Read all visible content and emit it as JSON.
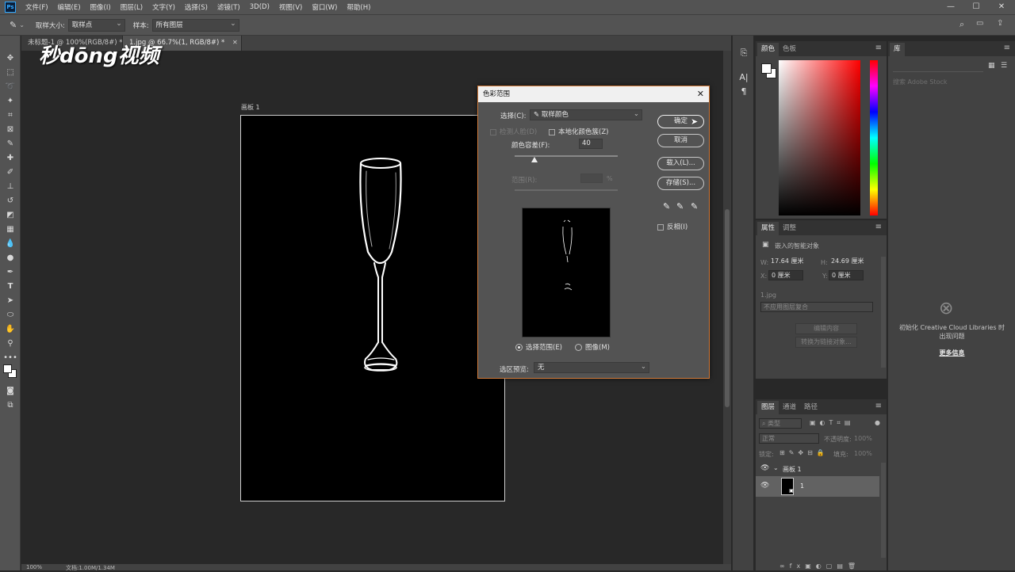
{
  "app": {
    "logo": "Ps"
  },
  "menubar": {
    "items": [
      "文件(F)",
      "编辑(E)",
      "图像(I)",
      "图层(L)",
      "文字(Y)",
      "选择(S)",
      "滤镜(T)",
      "3D(D)",
      "视图(V)",
      "窗口(W)",
      "帮助(H)"
    ],
    "minimize": "—",
    "maximize": "☐",
    "close": "✕"
  },
  "options": {
    "sample_size_label": "取样大小:",
    "sample_size_value": "取样点",
    "sample_label": "样本:",
    "sample_value": "所有图层"
  },
  "watermark": "秒dōng视频",
  "doc_tabs": [
    {
      "label": "未标题-1 @ 100%(RGB/8#) *"
    },
    {
      "label": "1.jpg @ 66.7%(1, RGB/8#) *"
    }
  ],
  "canvas": {
    "artboard_label": "画板 1"
  },
  "status": {
    "zoom": "100%",
    "doc": "文档:1.00M/1.34M"
  },
  "dialog": {
    "title": "色彩范围",
    "close": "✕",
    "select_label": "选择(C):",
    "select_value": "取样颜色",
    "detect_faces": "检测人脸(D)",
    "localized": "本地化颜色簇(Z)",
    "fuzziness_label": "颜色容差(F):",
    "fuzziness_value": "40",
    "range_label": "范围(R):",
    "range_unit": "%",
    "radio_selection": "选择范围(E)",
    "radio_image": "图像(M)",
    "preview_label": "选区预览:",
    "preview_value": "无",
    "btn_ok": "确定",
    "btn_cancel": "取消",
    "btn_load": "载入(L)...",
    "btn_save": "存储(S)...",
    "invert": "反相(I)"
  },
  "color_panel": {
    "tabs": [
      "颜色",
      "色板"
    ],
    "accent": "#ff0000"
  },
  "properties_panel": {
    "tabs": [
      "属性",
      "调整"
    ],
    "object_type": "嵌入的智能对象",
    "w_label": "W:",
    "w_value": "17.64 厘米",
    "h_label": "H:",
    "h_value": "24.69 厘米",
    "x_label": "X:",
    "x_value": "0 厘米",
    "y_label": "Y:",
    "y_value": "0 厘米",
    "file": "1.jpg",
    "comp": "不应用图层复合",
    "edit_contents": "编辑内容",
    "convert_linked": "转换为链接对象..."
  },
  "library_panel": {
    "tab": "库",
    "search_placeholder": "搜索 Adobe Stock",
    "error": "初始化 Creative Cloud Libraries 时出现问题",
    "more_info": "更多信息"
  },
  "layers_panel": {
    "tabs": [
      "图层",
      "通道",
      "路径"
    ],
    "filter_placeholder": "类型",
    "blend_mode": "正常",
    "opacity_label": "不透明度:",
    "opacity_value": "100%",
    "lock_label": "锁定:",
    "fill_label": "填充:",
    "fill_value": "100%",
    "layers": [
      {
        "name": "画板 1",
        "type": "artboard"
      },
      {
        "name": "1",
        "type": "smart-object"
      }
    ]
  }
}
